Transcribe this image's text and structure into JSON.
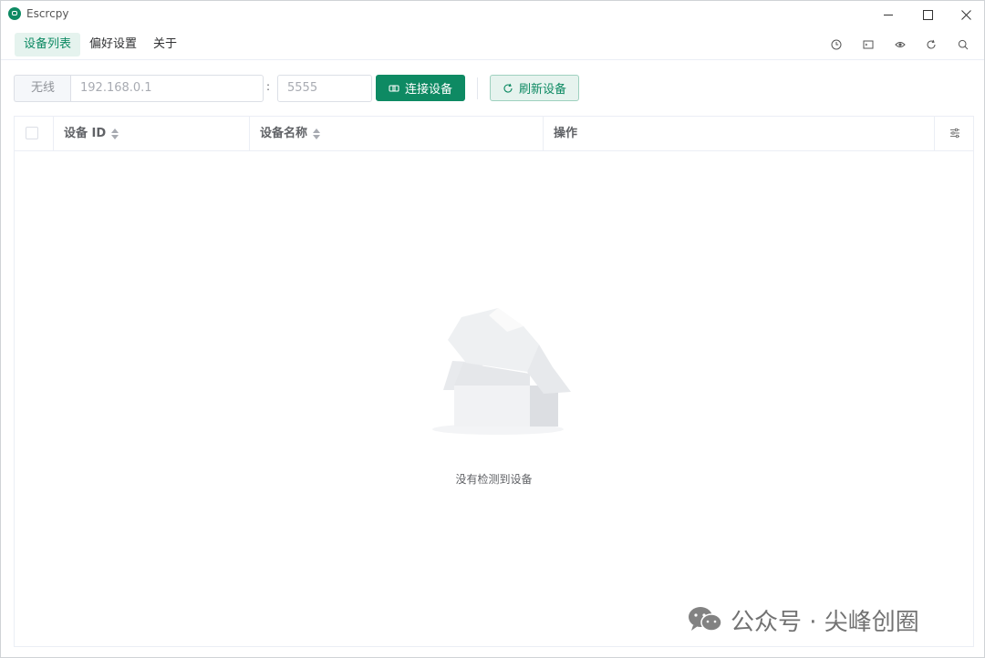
{
  "app": {
    "title": "Escrcpy"
  },
  "menu": {
    "items": [
      "设备列表",
      "偏好设置",
      "关于"
    ],
    "active_index": 0
  },
  "toolbar": {
    "addon_label": "无线",
    "ip_placeholder": "192.168.0.1",
    "colon": ":",
    "port_placeholder": "5555",
    "connect_label": "连接设备",
    "refresh_label": "刷新设备"
  },
  "table": {
    "columns": [
      "设备 ID",
      "设备名称",
      "操作"
    ],
    "empty_text": "没有检测到设备"
  },
  "tool_icons": [
    "clock-icon",
    "terminal-icon",
    "eye-icon",
    "refresh-icon",
    "search-icon"
  ],
  "watermark": {
    "text": "公众号 · 尖峰创圈"
  },
  "colors": {
    "accent": "#0e8a63",
    "accent_light": "#e6f3ee"
  }
}
